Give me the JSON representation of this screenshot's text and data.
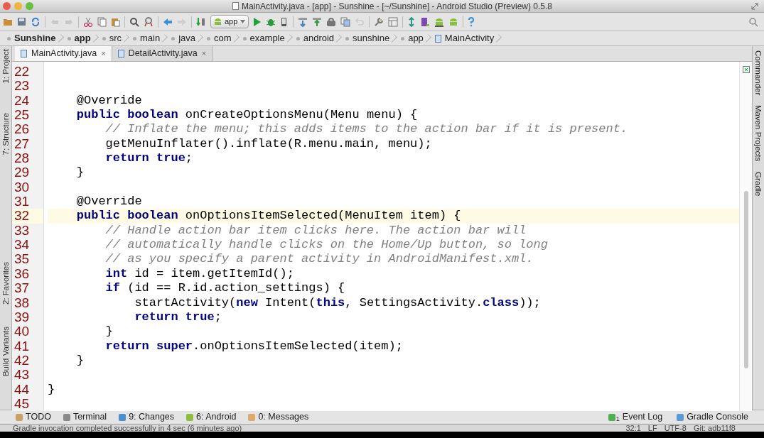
{
  "window": {
    "title": "MainActivity.java - [app] - Sunshine - [~/Sunshine] - Android Studio (Preview) 0.5.8"
  },
  "toolbar": {
    "run_config": "app"
  },
  "breadcrumbs": [
    {
      "label": "Sunshine",
      "bold": true
    },
    {
      "label": "app",
      "bold": true
    },
    {
      "label": "src",
      "bold": false
    },
    {
      "label": "main",
      "bold": false
    },
    {
      "label": "java",
      "bold": false
    },
    {
      "label": "com",
      "bold": false
    },
    {
      "label": "example",
      "bold": false
    },
    {
      "label": "android",
      "bold": false
    },
    {
      "label": "sunshine",
      "bold": false
    },
    {
      "label": "app",
      "bold": false
    },
    {
      "label": "MainActivity",
      "bold": false
    }
  ],
  "editor_tabs": [
    {
      "label": "MainActivity.java",
      "close": "×",
      "selected": true
    },
    {
      "label": "DetailActivity.java",
      "close": "×",
      "selected": false
    }
  ],
  "left_tool_windows": [
    "1: Project",
    "7: Structure",
    "2: Favorites",
    "Build Variants"
  ],
  "right_tool_windows": [
    "Commander",
    "Maven Projects",
    "Gradle"
  ],
  "code_lines": [
    {
      "number": "22",
      "selected": false
    },
    {
      "number": "23",
      "selected": false
    },
    {
      "number": "24",
      "selected": false,
      "tokens": [
        {
          "kind": "plain",
          "text": "    @Override"
        }
      ]
    },
    {
      "number": "25",
      "selected": false,
      "tokens": [
        {
          "kind": "keyword",
          "text": "    public boolean "
        },
        {
          "kind": "plain",
          "text": "onCreateOptionsMenu(Menu menu) {"
        }
      ]
    },
    {
      "number": "26",
      "selected": false,
      "tokens": [
        {
          "kind": "comment",
          "text": "        // Inflate the menu; this adds items to the action bar if it is present."
        }
      ]
    },
    {
      "number": "27",
      "selected": false,
      "tokens": [
        {
          "kind": "plain",
          "text": "        getMenuInflater().inflate(R.menu.main, menu);"
        }
      ]
    },
    {
      "number": "28",
      "selected": false,
      "tokens": [
        {
          "kind": "keyword",
          "text": "        return true"
        },
        {
          "kind": "plain",
          "text": ";"
        }
      ]
    },
    {
      "number": "29",
      "selected": false,
      "tokens": [
        {
          "kind": "plain",
          "text": "    }"
        }
      ]
    },
    {
      "number": "30",
      "selected": false
    },
    {
      "number": "31",
      "selected": false,
      "tokens": [
        {
          "kind": "plain",
          "text": "    @Override"
        }
      ]
    },
    {
      "number": "32",
      "selected": true,
      "tokens": [
        {
          "kind": "keyword",
          "text": "    public boolean "
        },
        {
          "kind": "plain",
          "text": "onOptionsItemSelected(MenuItem item) {"
        }
      ]
    },
    {
      "number": "33",
      "selected": false,
      "tokens": [
        {
          "kind": "comment",
          "text": "        // Handle action bar item clicks here. The action bar will"
        }
      ]
    },
    {
      "number": "34",
      "selected": false,
      "tokens": [
        {
          "kind": "comment",
          "text": "        // automatically handle clicks on the Home/Up button, so long"
        }
      ]
    },
    {
      "number": "35",
      "selected": false,
      "tokens": [
        {
          "kind": "comment",
          "text": "        // as you specify a parent activity in AndroidManifest.xml."
        }
      ]
    },
    {
      "number": "36",
      "selected": false,
      "tokens": [
        {
          "kind": "keyword",
          "text": "        int "
        },
        {
          "kind": "plain",
          "text": "id = item.getItemId();"
        }
      ]
    },
    {
      "number": "37",
      "selected": false,
      "tokens": [
        {
          "kind": "keyword",
          "text": "        if "
        },
        {
          "kind": "plain",
          "text": "(id == R.id.action_settings) {"
        }
      ]
    },
    {
      "number": "38",
      "selected": false,
      "tokens": [
        {
          "kind": "plain",
          "text": "            startActivity("
        },
        {
          "kind": "keyword",
          "text": "new "
        },
        {
          "kind": "plain",
          "text": "Intent("
        },
        {
          "kind": "keyword",
          "text": "this"
        },
        {
          "kind": "plain",
          "text": ", SettingsActivity."
        },
        {
          "kind": "keyword",
          "text": "class"
        },
        {
          "kind": "plain",
          "text": "));"
        }
      ]
    },
    {
      "number": "39",
      "selected": false,
      "tokens": [
        {
          "kind": "keyword",
          "text": "            return true"
        },
        {
          "kind": "plain",
          "text": ";"
        }
      ]
    },
    {
      "number": "40",
      "selected": false,
      "tokens": [
        {
          "kind": "plain",
          "text": "        }"
        }
      ]
    },
    {
      "number": "41",
      "selected": false,
      "tokens": [
        {
          "kind": "keyword",
          "text": "        return super"
        },
        {
          "kind": "plain",
          "text": ".onOptionsItemSelected(item);"
        }
      ]
    },
    {
      "number": "42",
      "selected": false,
      "tokens": [
        {
          "kind": "plain",
          "text": "    }"
        }
      ]
    },
    {
      "number": "43",
      "selected": false
    },
    {
      "number": "44",
      "selected": false,
      "tokens": [
        {
          "kind": "plain",
          "text": "}"
        }
      ]
    },
    {
      "number": "45",
      "selected": false
    }
  ],
  "bottom_tool_windows": [
    {
      "label": "TODO",
      "color": "#c9a26a"
    },
    {
      "label": "Terminal",
      "color": "#8a8a8a"
    },
    {
      "label": "9: Changes",
      "color": "#4a8fd0"
    },
    {
      "label": "6: Android",
      "color": "#8cbf3f"
    },
    {
      "label": "0: Messages",
      "color": "#e0a86a"
    }
  ],
  "bottom_right_tool_windows": [
    {
      "label": "Event Log",
      "badge": "1",
      "color": "#4caf50"
    },
    {
      "label": "Gradle Console",
      "color": "#5b9bd5"
    }
  ],
  "status_bar": {
    "message": "Gradle invocation completed successfully in 4 sec (6 minutes ago)",
    "position": "32:1",
    "line_separator": "LF",
    "encoding": "UTF-8",
    "vcs": "Git: adb11f8"
  }
}
